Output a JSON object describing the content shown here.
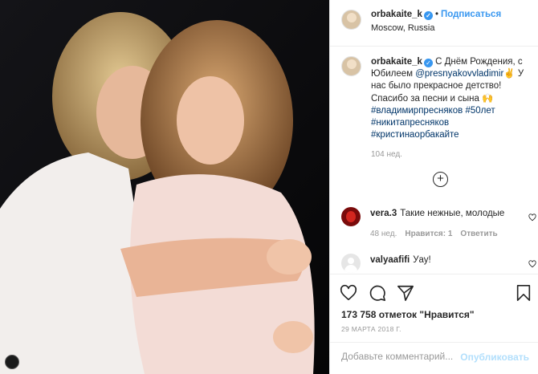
{
  "post": {
    "author": "orbakaite_k",
    "follow_label": "Подписаться",
    "location": "Moscow, Russia",
    "caption": {
      "author": "orbakaite_k",
      "text_1": " С Днём Рождения, с Юбилеем ",
      "mention": "@presnyakovvladimir",
      "text_2": "✌️ У нас было прекрасное детство! Спасибо за песни и сына 🙌",
      "tag_1": "#владимирпресняков",
      "tag_2": "#50лет",
      "tag_3": "#никитапресняков",
      "tag_4": "#кристинаорбакайте",
      "time": "104 нед."
    },
    "load_more": "+",
    "comments": [
      {
        "user": "vera.3",
        "text": "Такие нежные, молодые",
        "time": "48 нед.",
        "likes": "Нравится: 1",
        "reply": "Ответить"
      },
      {
        "user": "valyaafifi",
        "text": "Уау!"
      }
    ],
    "likes": "173 758 отметок \"Нравится\"",
    "date": "29 МАРТА 2018 Г.",
    "comment_placeholder": "Добавьте комментарий...",
    "publish_label": "Опубликовать"
  },
  "icons": {
    "verified": "verified-badge",
    "like": "heart-icon",
    "comment": "speech-bubble-icon",
    "share": "paper-plane-icon",
    "save": "bookmark-icon"
  },
  "colors": {
    "link": "#003569",
    "accent": "#3897f0",
    "publish_disabled": "#b2dffc",
    "muted": "#999999"
  }
}
